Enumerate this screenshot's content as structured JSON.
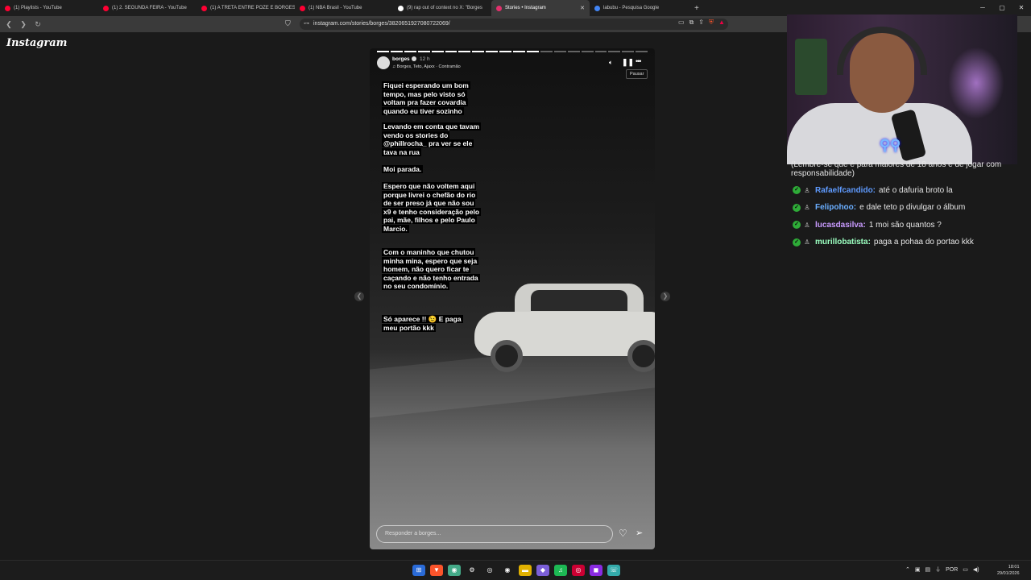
{
  "browser": {
    "tabs": [
      {
        "title": "(1) Playlists - YouTube",
        "color": "#ff0033"
      },
      {
        "title": "(1) 2. SEGUNDA FEIRA - YouTube",
        "color": "#ff0033"
      },
      {
        "title": "(1) A TRETA ENTRE POZE E BORGES",
        "color": "#ff0033"
      },
      {
        "title": "(1) NBA Brasil - YouTube",
        "color": "#ff0033"
      },
      {
        "title": "(9) rap out of context no X: \"Borges",
        "color": "#ffffff"
      },
      {
        "title": "Stories • Instagram",
        "color": "#e1306c",
        "active": true
      },
      {
        "title": "labubu - Pesquisa Google",
        "color": "#4285f4"
      }
    ],
    "new_tab": "+",
    "url": "instagram.com/stories/borges/3820651927080722069/"
  },
  "instagram": {
    "logo": "Instagram",
    "story": {
      "username": "borges",
      "time": "12 h",
      "music": "Borges, Teto, Ajaxx · Contramão",
      "tooltip": "Pausar",
      "progress_total": 20,
      "progress_done": 12,
      "captions": [
        "Fiquei esperando um bom tempo, mas pelo visto só voltam pra fazer covardia quando eu tiver sozinho",
        "Levando em conta que tavam vendo os stories do @phillrocha_ pra ver se ele tava na rua",
        "Moi parada.",
        "Espero que não voltem aqui porque livrei o chefão do rio de ser preso já que não sou x9 e tenho consideração pelo pai, mãe, filhos e pelo Paulo Marcio.",
        "Com o maninho que chutou minha mina, espero que seja homem, não quero ficar te caçando e não tenho entrada no seu condomínio.",
        "Só aparece !! 😉 E paga meu portão kkk"
      ],
      "reply_placeholder": "Responder a borges..."
    }
  },
  "chat": {
    "top_text": "(Lembre-se que é para maiores de 18 anos e de jogar com responsabilidade)",
    "messages": [
      {
        "user": "Rafaelfcandido:",
        "text": "até o dafuria broto la",
        "color": "#5f9bff"
      },
      {
        "user": "Felipohoo:",
        "text": "e dale teto p divulgar o álbum",
        "color": "#6aaeff"
      },
      {
        "user": "lucasdasilva:",
        "text": "1 moi são quantos ?",
        "color": "#c99bff"
      },
      {
        "user": "murillobatista:",
        "text": "paga a pohaa do portao kkk",
        "color": "#9bffc0"
      }
    ]
  },
  "taskbar": {
    "lang": "POR",
    "time": "18:01",
    "date": "29/01/2026"
  }
}
